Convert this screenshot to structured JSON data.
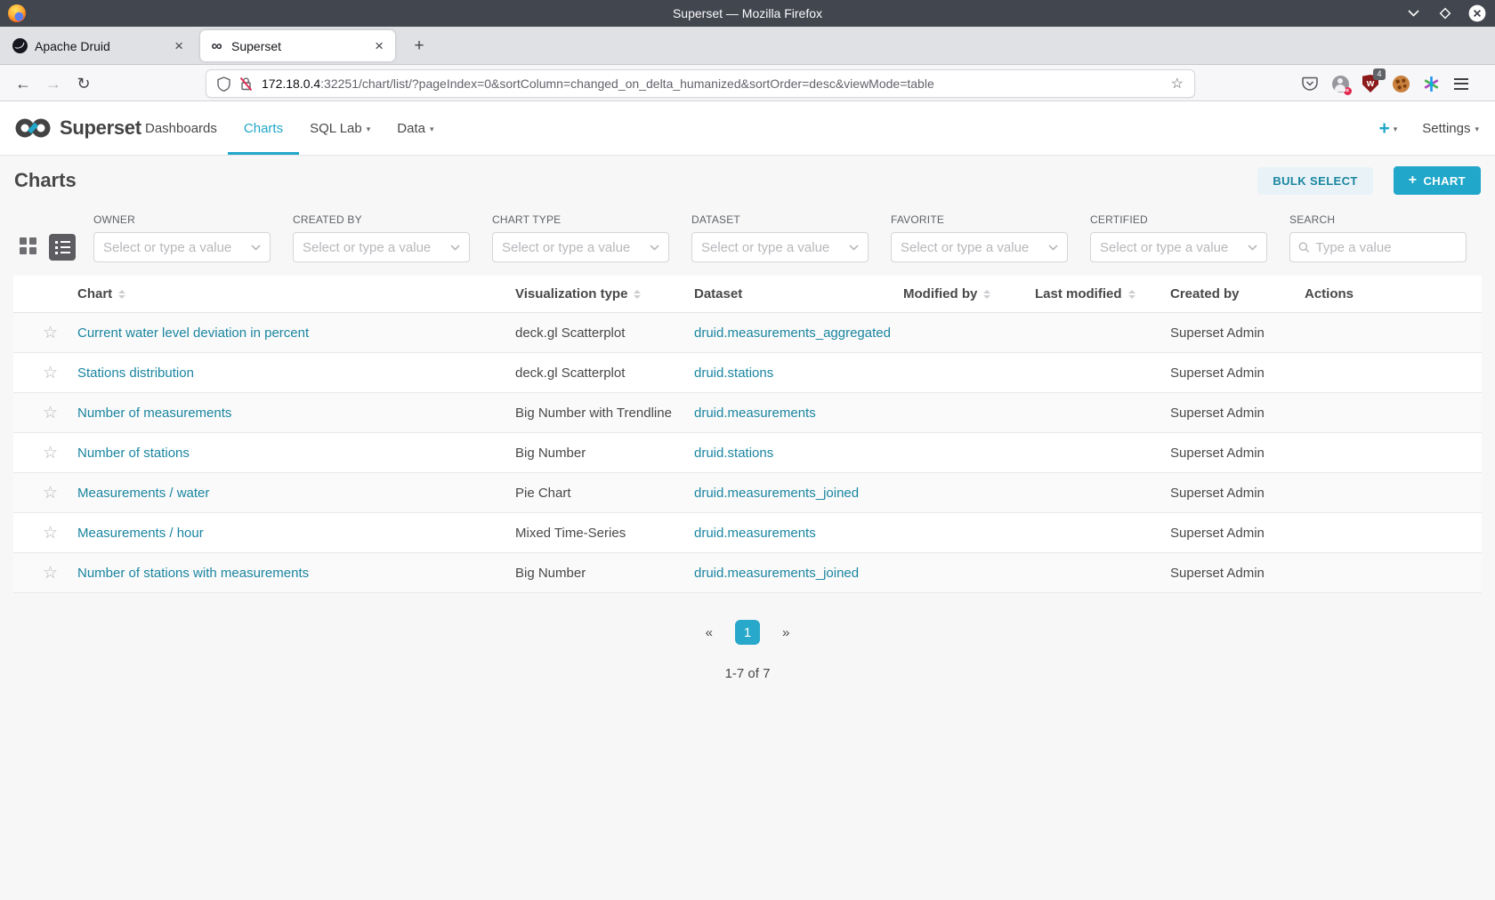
{
  "glyphs": {
    "close_tab": "×",
    "new_tab": "+",
    "back": "←",
    "forward": "→",
    "reload": "↻",
    "star_outline": "☆",
    "bookmark_star": "☆",
    "superset_favicon": "∞",
    "caret_down": "▾",
    "plus": "+",
    "prev": "«",
    "next": "»"
  },
  "colors": {
    "accent": "#20a7c9",
    "link": "#1a85a0",
    "titlebar": "#42464e",
    "page_bg": "#f7f7f7"
  },
  "browser": {
    "window_title": "Superset — Mozilla Firefox",
    "tabs": [
      {
        "label": "Apache Druid"
      },
      {
        "label": "Superset"
      }
    ],
    "url_host": "172.18.0.4",
    "url_rest": ":32251/chart/list/?pageIndex=0&sortColumn=changed_on_delta_humanized&sortOrder=desc&viewMode=table",
    "extension_badge": "4",
    "account_error": "×",
    "shield_letter": "w"
  },
  "nav": {
    "brand": "Superset",
    "items": [
      {
        "label": "Dashboards"
      },
      {
        "label": "Charts"
      },
      {
        "label": "SQL Lab"
      },
      {
        "label": "Data"
      }
    ],
    "settings_label": "Settings"
  },
  "page": {
    "title": "Charts",
    "bulk_select_label": "BULK SELECT",
    "add_chart_label": "CHART"
  },
  "filters": {
    "selects": [
      {
        "label": "OWNER",
        "placeholder": "Select or type a value"
      },
      {
        "label": "CREATED BY",
        "placeholder": "Select or type a value"
      },
      {
        "label": "CHART TYPE",
        "placeholder": "Select or type a value"
      },
      {
        "label": "DATASET",
        "placeholder": "Select or type a value"
      },
      {
        "label": "FAVORITE",
        "placeholder": "Select or type a value"
      },
      {
        "label": "CERTIFIED",
        "placeholder": "Select or type a value"
      }
    ],
    "search": {
      "label": "SEARCH",
      "placeholder": "Type a value"
    }
  },
  "table": {
    "columns": [
      {
        "label": "Chart",
        "sortable": true
      },
      {
        "label": "Visualization type",
        "sortable": true
      },
      {
        "label": "Dataset",
        "sortable": false
      },
      {
        "label": "Modified by",
        "sortable": true
      },
      {
        "label": "Last modified",
        "sortable": true
      },
      {
        "label": "Created by",
        "sortable": false
      },
      {
        "label": "Actions",
        "sortable": false
      }
    ],
    "rows": [
      {
        "chart": "Current water level deviation in percent",
        "viz_type": "deck.gl Scatterplot",
        "dataset": "druid.measurements_aggregated",
        "modified_by": "",
        "last_modified": "",
        "created_by": "Superset Admin"
      },
      {
        "chart": "Stations distribution",
        "viz_type": "deck.gl Scatterplot",
        "dataset": "druid.stations",
        "modified_by": "",
        "last_modified": "",
        "created_by": "Superset Admin"
      },
      {
        "chart": "Number of measurements",
        "viz_type": "Big Number with Trendline",
        "dataset": "druid.measurements",
        "modified_by": "",
        "last_modified": "",
        "created_by": "Superset Admin"
      },
      {
        "chart": "Number of stations",
        "viz_type": "Big Number",
        "dataset": "druid.stations",
        "modified_by": "",
        "last_modified": "",
        "created_by": "Superset Admin"
      },
      {
        "chart": "Measurements / water",
        "viz_type": "Pie Chart",
        "dataset": "druid.measurements_joined",
        "modified_by": "",
        "last_modified": "",
        "created_by": "Superset Admin"
      },
      {
        "chart": "Measurements / hour",
        "viz_type": "Mixed Time-Series",
        "dataset": "druid.measurements",
        "modified_by": "",
        "last_modified": "",
        "created_by": "Superset Admin"
      },
      {
        "chart": "Number of stations with measurements",
        "viz_type": "Big Number",
        "dataset": "druid.measurements_joined",
        "modified_by": "",
        "last_modified": "",
        "created_by": "Superset Admin"
      }
    ]
  },
  "pagination": {
    "page": "1",
    "summary": "1-7 of 7"
  }
}
